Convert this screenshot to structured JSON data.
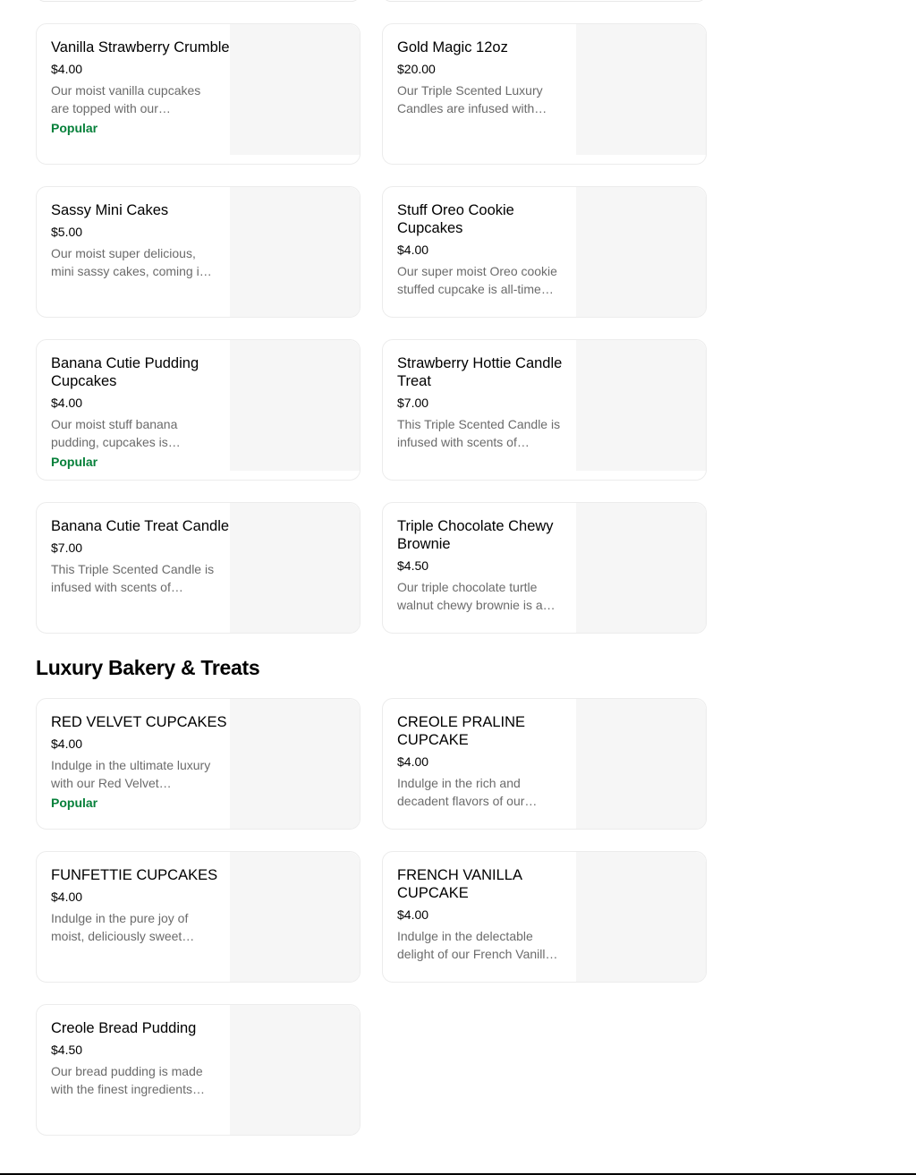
{
  "colors": {
    "popular_badge": "#06803a",
    "description_text": "#6b6b6b",
    "card_border": "#ececec",
    "image_placeholder": "#f6f6f6"
  },
  "section_top": {
    "items": [
      {
        "title": "Vanilla Strawberry Crumble",
        "price": "$4.00",
        "description": "Our moist vanilla cupcakes are topped with our…",
        "badge": "Popular"
      },
      {
        "title": "Gold Magic 12oz",
        "price": "$20.00",
        "description": "Our Triple Scented Luxury Candles are infused with…",
        "badge": ""
      },
      {
        "title": "Sassy Mini Cakes",
        "price": "$5.00",
        "description": "Our moist super delicious, mini sassy cakes, coming i…",
        "badge": ""
      },
      {
        "title": "Stuff Oreo Cookie Cupcakes",
        "price": "$4.00",
        "description": "Our super moist Oreo cookie stuffed cupcake is all-time…",
        "badge": ""
      },
      {
        "title": "Banana Cutie Pudding Cupcakes",
        "price": "$4.00",
        "description": "Our moist stuff banana pudding, cupcakes is…",
        "badge": "Popular"
      },
      {
        "title": "Strawberry Hottie Candle Treat",
        "price": "$7.00",
        "description": "This Triple Scented Candle is infused with scents of…",
        "badge": ""
      },
      {
        "title": "Banana Cutie Treat Candle",
        "price": "$7.00",
        "description": "This Triple Scented Candle is infused with scents of…",
        "badge": ""
      },
      {
        "title": "Triple Chocolate Chewy Brownie",
        "price": "$4.50",
        "description": "Our triple chocolate turtle walnut chewy brownie is a…",
        "badge": ""
      }
    ]
  },
  "section_luxury": {
    "title": "Luxury Bakery & Treats",
    "items": [
      {
        "title": "RED VELVET CUPCAKES",
        "price": "$4.00",
        "description": "Indulge in the ultimate luxury with our Red Velvet…",
        "badge": "Popular"
      },
      {
        "title": "CREOLE PRALINE CUPCAKE",
        "price": "$4.00",
        "description": "Indulge in the rich and decadent flavors of our…",
        "badge": ""
      },
      {
        "title": "FUNFETTIE CUPCAKES",
        "price": "$4.00",
        "description": "Indulge in the pure joy of moist, deliciously sweet…",
        "badge": ""
      },
      {
        "title": "FRENCH VANILLA CUPCAKE",
        "price": "$4.00",
        "description": "Indulge in the delectable delight of our French Vanill…",
        "badge": ""
      },
      {
        "title": "Creole Bread Pudding",
        "price": "$4.50",
        "description": "Our bread pudding is made with the finest ingredients…",
        "badge": ""
      }
    ]
  }
}
